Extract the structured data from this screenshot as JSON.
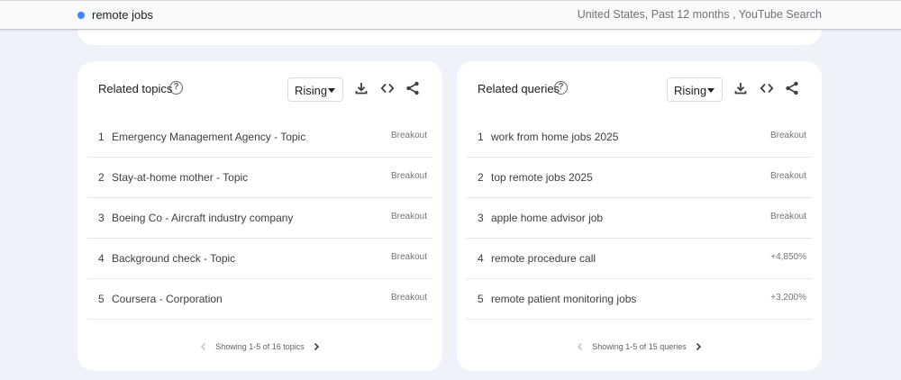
{
  "search": {
    "term": "remote jobs",
    "dot_color": "#4285f4",
    "meta": "United States, Past 12 months , YouTube Search"
  },
  "related_topics": {
    "title": "Related topics",
    "help_icon": "?",
    "filter_value": "Rising",
    "icons": [
      "download-icon",
      "embed-icon",
      "share-icon"
    ],
    "rows": [
      {
        "index": "1",
        "label": "Emergency Management Agency - Topic",
        "value": "Breakout"
      },
      {
        "index": "2",
        "label": "Stay-at-home mother - Topic",
        "value": "Breakout"
      },
      {
        "index": "3",
        "label": "Boeing Co - Aircraft industry company",
        "value": "Breakout"
      },
      {
        "index": "4",
        "label": "Background check - Topic",
        "value": "Breakout"
      },
      {
        "index": "5",
        "label": "Coursera - Corporation",
        "value": "Breakout"
      }
    ],
    "pager": "Showing 1-5 of 16 topics"
  },
  "related_queries": {
    "title": "Related queries",
    "help_icon": "?",
    "filter_value": "Rising",
    "icons": [
      "download-icon",
      "embed-icon",
      "share-icon"
    ],
    "rows": [
      {
        "index": "1",
        "label": "work from home jobs 2025",
        "value": "Breakout"
      },
      {
        "index": "2",
        "label": "top remote jobs 2025",
        "value": "Breakout"
      },
      {
        "index": "3",
        "label": "apple home advisor job",
        "value": "Breakout"
      },
      {
        "index": "4",
        "label": "remote procedure call",
        "value": "+4,850%"
      },
      {
        "index": "5",
        "label": "remote patient monitoring jobs",
        "value": "+3,200%"
      }
    ],
    "pager": "Showing 1-5 of 15 queries"
  }
}
